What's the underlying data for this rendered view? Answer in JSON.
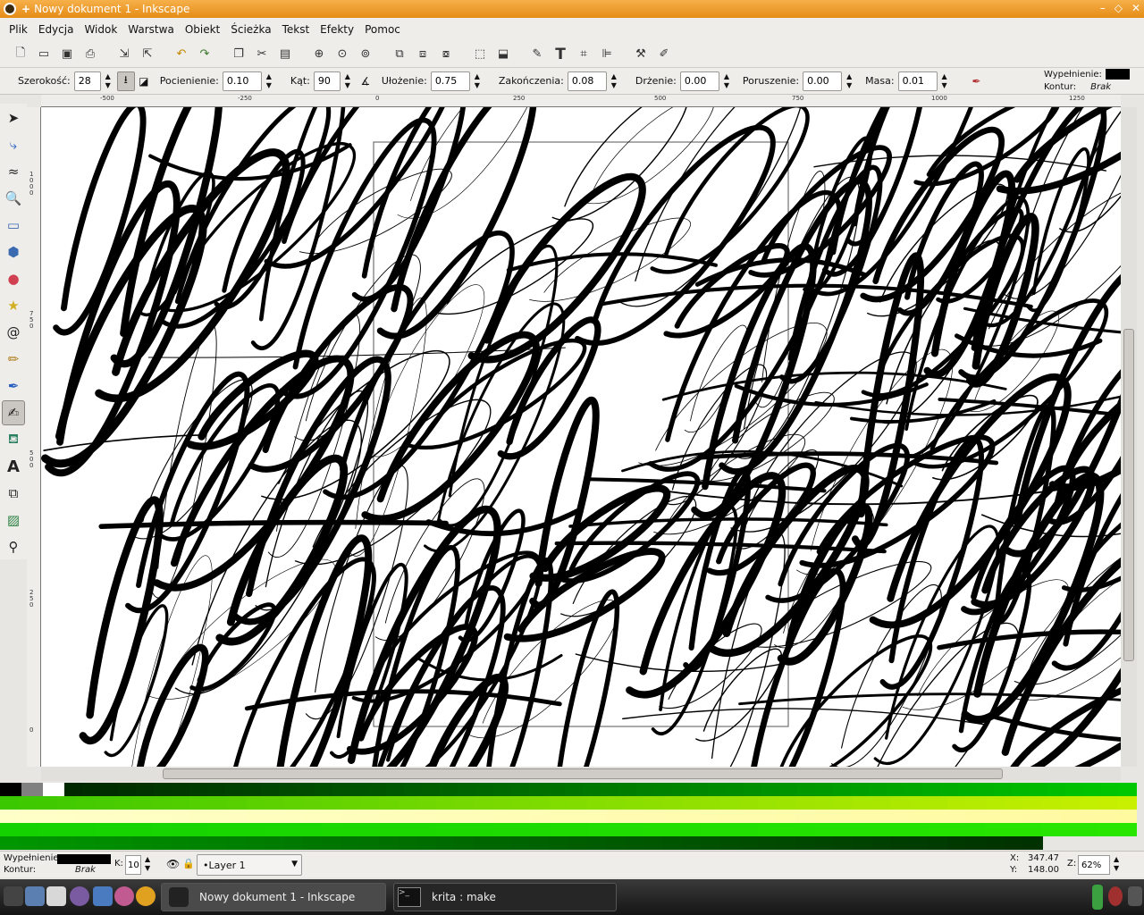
{
  "window": {
    "title": "Nowy dokument 1 - Inkscape"
  },
  "menu": [
    "Plik",
    "Edycja",
    "Widok",
    "Warstwa",
    "Obiekt",
    "Ścieżka",
    "Tekst",
    "Efekty",
    "Pomoc"
  ],
  "controls": {
    "width_label": "Szerokość:",
    "width_value": "28",
    "thinning_label": "Pocienienie:",
    "thinning_value": "0.10",
    "angle_label": "Kąt:",
    "angle_value": "90",
    "fixation_label": "Ułożenie:",
    "fixation_value": "0.75",
    "caps_label": "Zakończenia:",
    "caps_value": "0.08",
    "tremor_label": "Drżenie:",
    "tremor_value": "0.00",
    "wiggle_label": "Poruszenie:",
    "wiggle_value": "0.00",
    "mass_label": "Masa:",
    "mass_value": "0.01"
  },
  "style_indicator": {
    "fill_label": "Wypełnienie:",
    "stroke_label": "Kontur:",
    "stroke_value": "Brak"
  },
  "ruler": {
    "h_ticks": [
      "-500",
      "-250",
      "0",
      "250",
      "500",
      "750",
      "1000",
      "1250"
    ],
    "v_ticks": [
      "1000",
      "750",
      "500",
      "250",
      "0"
    ]
  },
  "status": {
    "fill_label": "Wypełnienie:",
    "stroke_label": "Kontur:",
    "stroke_value": "Brak",
    "opacity_label": "K:",
    "opacity_value": "10",
    "layer": "•Layer 1",
    "x_label": "X:",
    "x_value": "347.47",
    "y_label": "Y:",
    "y_value": "148.00",
    "zoom_label": "Z:",
    "zoom_value": "62%"
  },
  "taskbar": {
    "tasks": [
      "Nowy dokument 1 - Inkscape",
      "krita : make"
    ]
  },
  "colors": {
    "titlebar": "#e9951f",
    "accent_green": "#00a000"
  }
}
